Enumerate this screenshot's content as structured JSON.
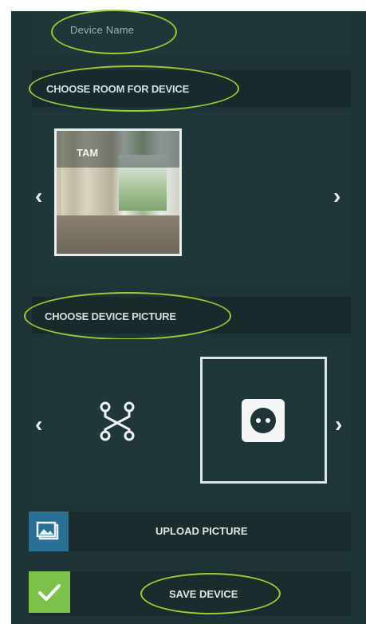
{
  "device_name": {
    "placeholder": "Device Name"
  },
  "room_section": {
    "title": "CHOOSE ROOM FOR DEVICE"
  },
  "room_carousel": {
    "current_room_label": "TAM",
    "prev_icon": "chevron-left",
    "next_icon": "chevron-right"
  },
  "picture_section": {
    "title": "CHOOSE DEVICE PICTURE"
  },
  "picture_carousel": {
    "options": [
      "network-hub-icon",
      "power-socket-icon"
    ],
    "selected": "power-socket-icon",
    "prev_icon": "chevron-left",
    "next_icon": "chevron-right"
  },
  "upload": {
    "label": "UPLOAD PICTURE",
    "icon": "image-upload-icon"
  },
  "save": {
    "label": "SAVE DEVICE",
    "icon": "checkmark-icon"
  },
  "colors": {
    "background": "#1f3436",
    "highlight_ring": "#9acd32",
    "upload_accent": "#2a6f94",
    "save_accent": "#7cc24a"
  }
}
